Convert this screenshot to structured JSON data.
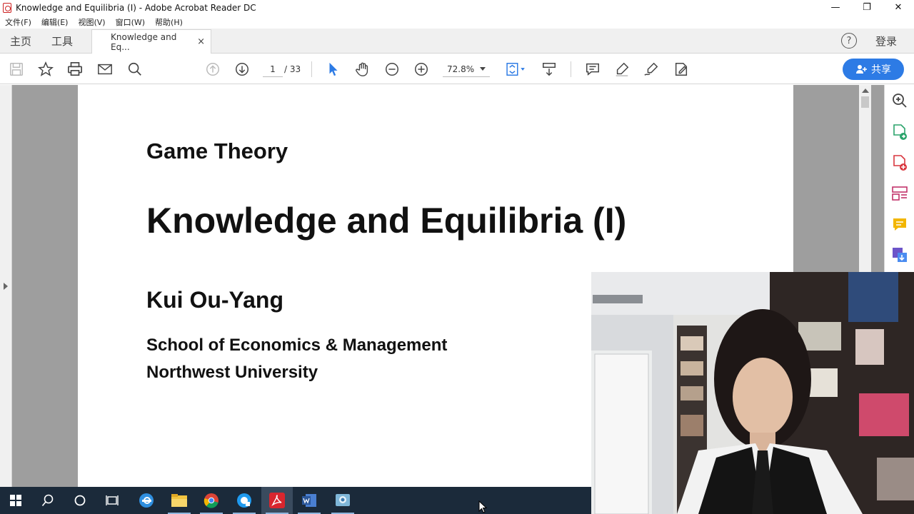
{
  "window": {
    "title": "Knowledge and Equilibria (I) - Adobe Acrobat Reader DC",
    "controls": {
      "minimize": "—",
      "restore": "❐",
      "close": "✕"
    }
  },
  "menu": [
    {
      "label": "文件(F)"
    },
    {
      "label": "编辑(E)"
    },
    {
      "label": "视图(V)"
    },
    {
      "label": "窗口(W)"
    },
    {
      "label": "帮助(H)"
    }
  ],
  "tabs": {
    "home": "主页",
    "tools": "工具",
    "document": "Knowledge and Eq...",
    "document_close": "×",
    "help": "?",
    "login": "登录"
  },
  "toolbar": {
    "page_current": "1",
    "page_total": "/ 33",
    "zoom": "72.8%",
    "share_label": "共享"
  },
  "document": {
    "line1": "Game Theory",
    "line2": "Knowledge and Equilibria (I)",
    "line3": "Kui Ou-Yang",
    "line4": "School of Economics & Management",
    "line5": "Northwest University"
  },
  "colors": {
    "accent": "#2d7be5",
    "taskbar": "#1b2a3a",
    "doc_background": "#9e9e9e"
  }
}
